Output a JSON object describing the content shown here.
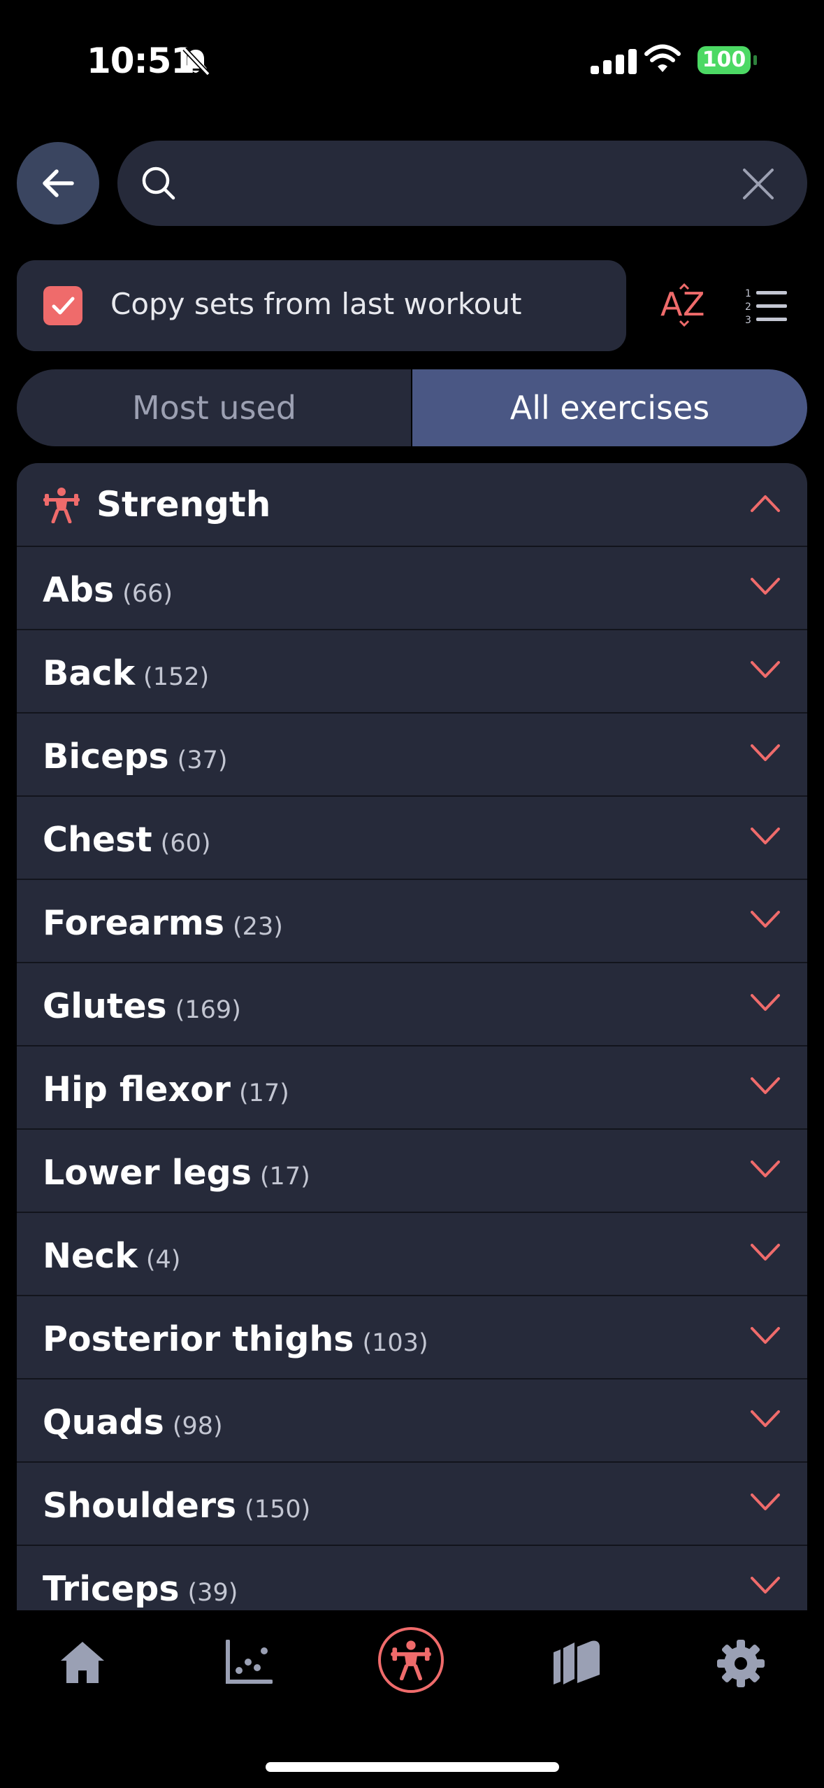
{
  "status_bar": {
    "time": "10:51",
    "battery": "100"
  },
  "search": {
    "placeholder": "",
    "value": ""
  },
  "options": {
    "copy_sets_label": "Copy sets from last workout",
    "copy_sets_checked": true
  },
  "tabs": {
    "most_used": "Most used",
    "all_exercises": "All exercises",
    "active": "All exercises"
  },
  "category": {
    "title": "Strength",
    "expanded": true,
    "groups": [
      {
        "name": "Abs",
        "count": "(66)"
      },
      {
        "name": "Back",
        "count": "(152)"
      },
      {
        "name": "Biceps",
        "count": "(37)"
      },
      {
        "name": "Chest",
        "count": "(60)"
      },
      {
        "name": "Forearms",
        "count": "(23)"
      },
      {
        "name": "Glutes",
        "count": "(169)"
      },
      {
        "name": "Hip flexor",
        "count": "(17)"
      },
      {
        "name": "Lower legs",
        "count": "(17)"
      },
      {
        "name": "Neck",
        "count": "(4)"
      },
      {
        "name": "Posterior thighs",
        "count": "(103)"
      },
      {
        "name": "Quads",
        "count": "(98)"
      },
      {
        "name": "Shoulders",
        "count": "(150)"
      },
      {
        "name": "Triceps",
        "count": "(39)"
      }
    ]
  },
  "tab_bar": {
    "items": [
      "home-icon",
      "stats-chart-icon",
      "workout-icon",
      "exercise-library-icon",
      "settings-gear-icon"
    ],
    "active": "workout-icon"
  },
  "colors": {
    "accent": "#ef6b6b",
    "panel": "#262a3a",
    "active_tab": "#4a5784",
    "background": "#000000"
  }
}
